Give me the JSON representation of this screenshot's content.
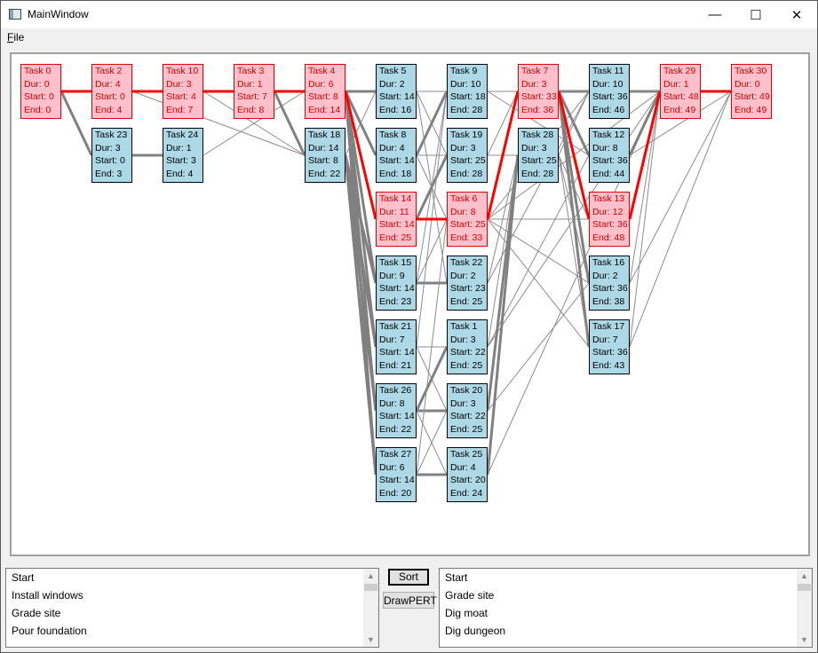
{
  "window": {
    "title": "MainWindow",
    "minimize_glyph": "—",
    "maximize_glyph": "☐",
    "close_glyph": "✕"
  },
  "menu": {
    "file_accel": "F",
    "file_rest": "ile"
  },
  "tasks": [
    {
      "label": "Task 0",
      "dur": "Dur: 0",
      "start": "Start: 0",
      "end": "End: 0",
      "critical": true
    },
    {
      "label": "Task 2",
      "dur": "Dur: 4",
      "start": "Start: 0",
      "end": "End: 4",
      "critical": true
    },
    {
      "label": "Task 23",
      "dur": "Dur: 3",
      "start": "Start: 0",
      "end": "End: 3",
      "critical": false
    },
    {
      "label": "Task 10",
      "dur": "Dur: 3",
      "start": "Start: 4",
      "end": "End: 7",
      "critical": true
    },
    {
      "label": "Task 24",
      "dur": "Dur: 1",
      "start": "Start: 3",
      "end": "End: 4",
      "critical": false
    },
    {
      "label": "Task 3",
      "dur": "Dur: 1",
      "start": "Start: 7",
      "end": "End: 8",
      "critical": true
    },
    {
      "label": "Task 4",
      "dur": "Dur: 6",
      "start": "Start: 8",
      "end": "End: 14",
      "critical": true
    },
    {
      "label": "Task 18",
      "dur": "Dur: 14",
      "start": "Start: 8",
      "end": "End: 22",
      "critical": false
    },
    {
      "label": "Task 5",
      "dur": "Dur: 2",
      "start": "Start: 14",
      "end": "End: 16",
      "critical": false
    },
    {
      "label": "Task 8",
      "dur": "Dur: 4",
      "start": "Start: 14",
      "end": "End: 18",
      "critical": false
    },
    {
      "label": "Task 14",
      "dur": "Dur: 11",
      "start": "Start: 14",
      "end": "End: 25",
      "critical": true
    },
    {
      "label": "Task 15",
      "dur": "Dur: 9",
      "start": "Start: 14",
      "end": "End: 23",
      "critical": false
    },
    {
      "label": "Task 21",
      "dur": "Dur: 7",
      "start": "Start: 14",
      "end": "End: 21",
      "critical": false
    },
    {
      "label": "Task 26",
      "dur": "Dur: 8",
      "start": "Start: 14",
      "end": "End: 22",
      "critical": false
    },
    {
      "label": "Task 27",
      "dur": "Dur: 6",
      "start": "Start: 14",
      "end": "End: 20",
      "critical": false
    },
    {
      "label": "Task 9",
      "dur": "Dur: 10",
      "start": "Start: 18",
      "end": "End: 28",
      "critical": false
    },
    {
      "label": "Task 19",
      "dur": "Dur: 3",
      "start": "Start: 25",
      "end": "End: 28",
      "critical": false
    },
    {
      "label": "Task 6",
      "dur": "Dur: 8",
      "start": "Start: 25",
      "end": "End: 33",
      "critical": true
    },
    {
      "label": "Task 22",
      "dur": "Dur: 2",
      "start": "Start: 23",
      "end": "End: 25",
      "critical": false
    },
    {
      "label": "Task 1",
      "dur": "Dur: 3",
      "start": "Start: 22",
      "end": "End: 25",
      "critical": false
    },
    {
      "label": "Task 20",
      "dur": "Dur: 3",
      "start": "Start: 22",
      "end": "End: 25",
      "critical": false
    },
    {
      "label": "Task 25",
      "dur": "Dur: 4",
      "start": "Start: 20",
      "end": "End: 24",
      "critical": false
    },
    {
      "label": "Task 7",
      "dur": "Dur: 3",
      "start": "Start: 33",
      "end": "End: 36",
      "critical": true
    },
    {
      "label": "Task 28",
      "dur": "Dur: 3",
      "start": "Start: 25",
      "end": "End: 28",
      "critical": false
    },
    {
      "label": "Task 11",
      "dur": "Dur: 10",
      "start": "Start: 36",
      "end": "End: 46",
      "critical": false
    },
    {
      "label": "Task 12",
      "dur": "Dur: 8",
      "start": "Start: 36",
      "end": "End: 44",
      "critical": false
    },
    {
      "label": "Task 13",
      "dur": "Dur: 12",
      "start": "Start: 36",
      "end": "End: 48",
      "critical": true
    },
    {
      "label": "Task 16",
      "dur": "Dur: 2",
      "start": "Start: 36",
      "end": "End: 38",
      "critical": false
    },
    {
      "label": "Task 17",
      "dur": "Dur: 7",
      "start": "Start: 36",
      "end": "End: 43",
      "critical": false
    },
    {
      "label": "Task 29",
      "dur": "Dur: 1",
      "start": "Start: 48",
      "end": "End: 49",
      "critical": true
    },
    {
      "label": "Task 30",
      "dur": "Dur: 0",
      "start": "Start: 49",
      "end": "End: 49",
      "critical": true
    }
  ],
  "left_list": {
    "items": [
      "Start",
      "Install windows",
      "Grade site",
      "Pour foundation"
    ]
  },
  "right_list": {
    "items": [
      "Start",
      "Grade site",
      "Dig moat",
      "Dig dungeon"
    ]
  },
  "buttons": {
    "sort": "Sort",
    "draw_pert": "DrawPERT"
  },
  "colors": {
    "critical_fill": "#ffc0cb",
    "critical_edge": "#e00000",
    "normal_fill": "#add8e6",
    "edge_gray": "#808080"
  }
}
